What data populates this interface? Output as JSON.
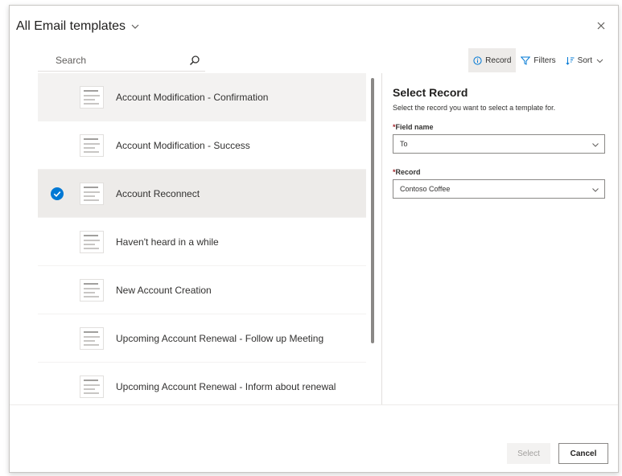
{
  "dialog": {
    "title": "All Email templates",
    "close_label": "Close"
  },
  "search": {
    "placeholder": "Search"
  },
  "toolbar": {
    "record_label": "Record",
    "filters_label": "Filters",
    "sort_label": "Sort"
  },
  "templates": [
    {
      "name": "Account Modification - Confirmation",
      "state": "hover"
    },
    {
      "name": "Account Modification - Success",
      "state": "normal"
    },
    {
      "name": "Account Reconnect",
      "state": "selected"
    },
    {
      "name": "Haven't heard in a while",
      "state": "normal"
    },
    {
      "name": "New Account Creation",
      "state": "normal"
    },
    {
      "name": "Upcoming Account Renewal - Follow up Meeting",
      "state": "normal"
    },
    {
      "name": "Upcoming Account Renewal - Inform about renewal",
      "state": "normal"
    }
  ],
  "panel": {
    "title": "Select Record",
    "description": "Select the record you want to select a template for.",
    "field_name_label": "Field name",
    "field_name_value": "To",
    "record_label": "Record",
    "record_value": "Contoso Coffee",
    "required_marker": "*"
  },
  "footer": {
    "select_label": "Select",
    "cancel_label": "Cancel"
  },
  "colors": {
    "accent": "#0078d4",
    "required": "#a4262c",
    "selected_row": "#edebe9"
  }
}
